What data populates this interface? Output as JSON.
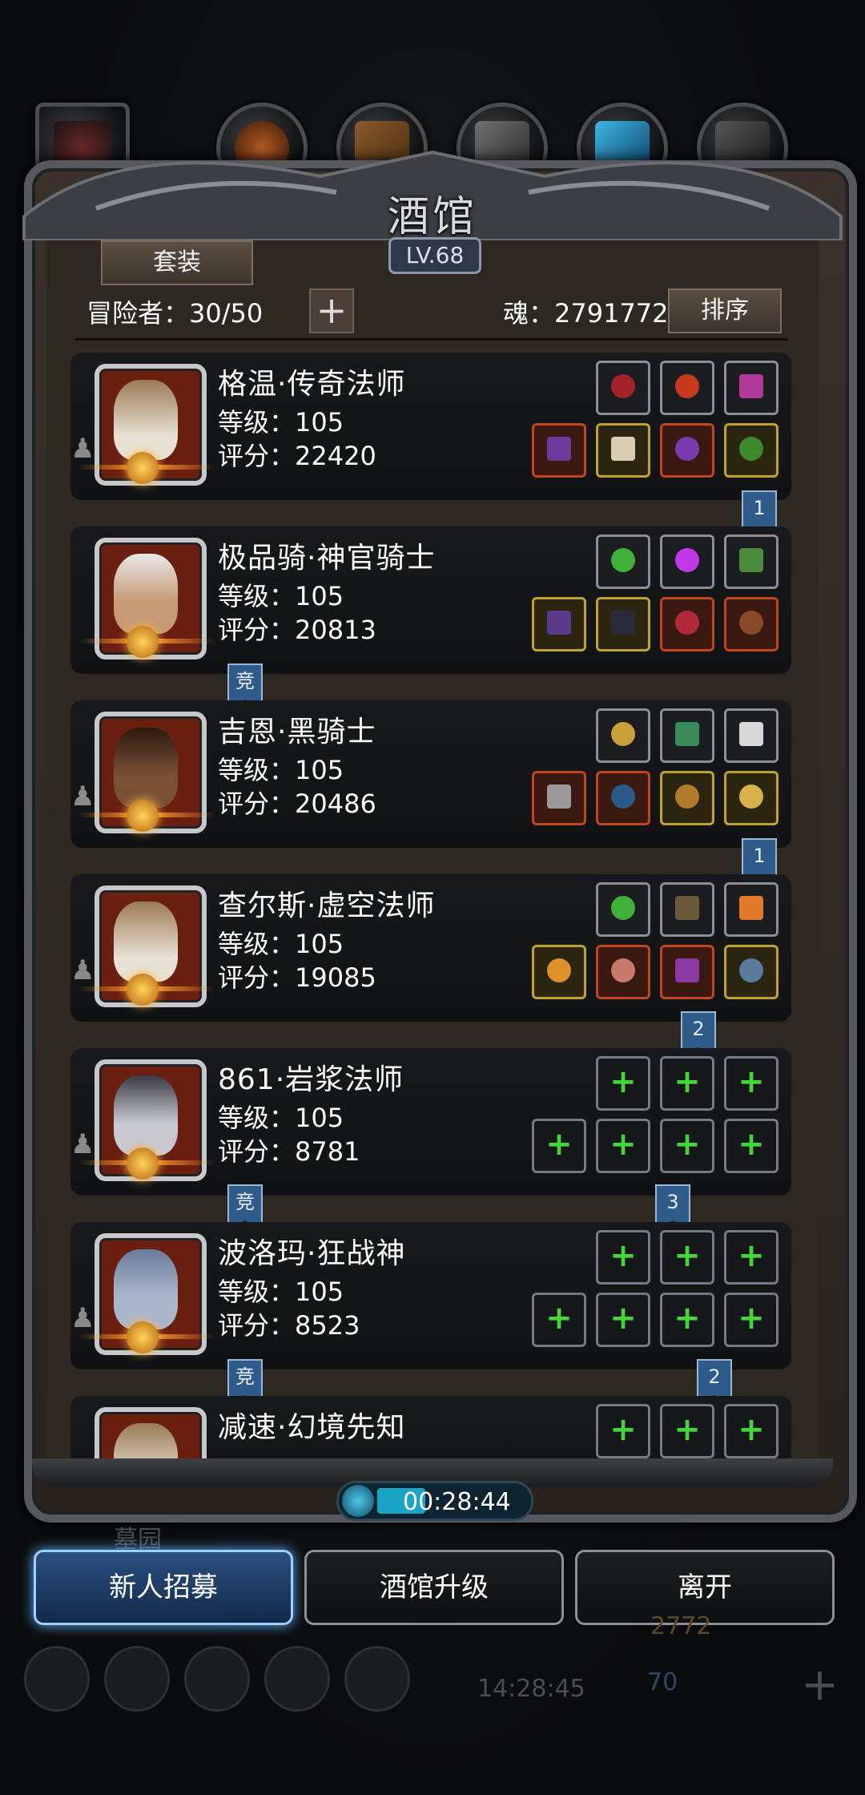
{
  "title": "酒馆",
  "level_badge": "LV.68",
  "set_button": "套装",
  "adventurer_count": "冒险者：30/50",
  "add_button": "+",
  "soul": "魂：2791772",
  "sort_button": "排序",
  "heroes": [
    {
      "name": "格温·传奇法师",
      "level": "等级：105",
      "score": "评分：22420",
      "tag": "1",
      "tag_type": "num"
    },
    {
      "name": "极品骑·神官骑士",
      "level": "等级：105",
      "score": "评分：20813",
      "tag": "竞",
      "tag_type": "left"
    },
    {
      "name": "吉恩·黑骑士",
      "level": "等级：105",
      "score": "评分：20486",
      "tag": "1",
      "tag_type": "num"
    },
    {
      "name": "查尔斯·虚空法师",
      "level": "等级：105",
      "score": "评分：19085",
      "tag": "2",
      "tag_type": "num"
    },
    {
      "name": "861·岩浆法师",
      "level": "等级：105",
      "score": "评分：8781",
      "tag": "竞",
      "tag_type": "left",
      "tag2": "3"
    },
    {
      "name": "波洛玛·狂战神",
      "level": "等级：105",
      "score": "评分：8523",
      "tag": "竞",
      "tag_type": "left",
      "tag2": "2"
    },
    {
      "name": "减速·幻境先知",
      "level": "",
      "score": "",
      "tag": "",
      "tag_type": ""
    }
  ],
  "timer": "00:28:44",
  "buttons": {
    "recruit": "新人招募",
    "upgrade": "酒馆升级",
    "leave": "离开"
  },
  "background_hints": {
    "left_label": "墓园",
    "coin": "2772",
    "clock": "14:28:45",
    "gems": "70"
  },
  "colors": {
    "accent": "#9fd0ff",
    "equip_green": "#45d43a",
    "tag_blue": "#2e5b8a"
  }
}
